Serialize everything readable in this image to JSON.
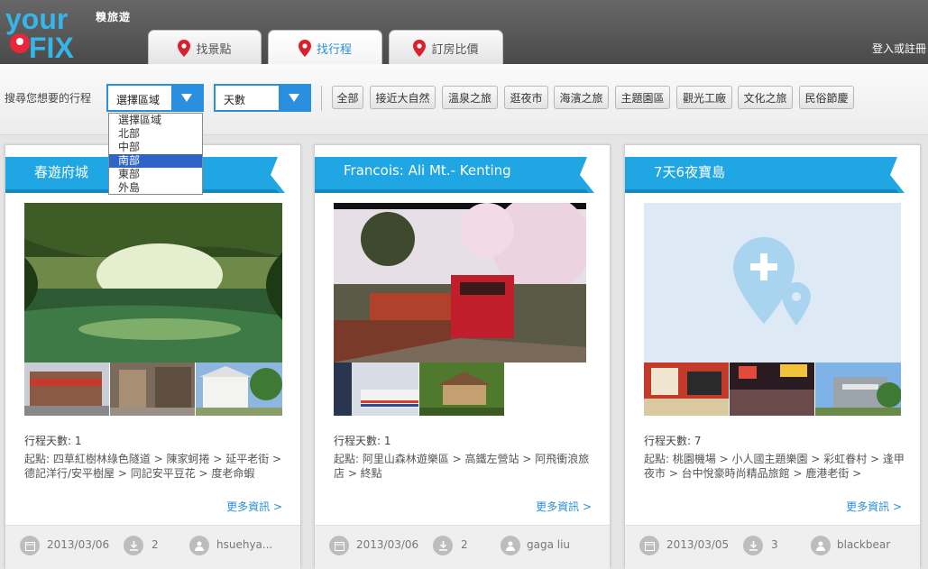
{
  "app": {
    "logo_text": "your FIX",
    "logo_sub": "糗旅遊",
    "login": "登入或註冊"
  },
  "tabs": [
    {
      "label": "找景點",
      "active": false
    },
    {
      "label": "找行程",
      "active": true
    },
    {
      "label": "訂房比價",
      "active": false
    }
  ],
  "search": {
    "label": "搜尋您想要的行程",
    "region_value": "選擇區域",
    "days_value": "天數",
    "region_options": [
      "選擇區域",
      "北部",
      "中部",
      "南部",
      "東部",
      "外島"
    ],
    "region_highlighted": "南部"
  },
  "filters": [
    "全部",
    "接近大自然",
    "溫泉之旅",
    "逛夜市",
    "海濱之旅",
    "主題園區",
    "觀光工廠",
    "文化之旅",
    "民俗節慶"
  ],
  "cards": [
    {
      "title": "春遊府城",
      "days": "行程天數: 1",
      "route": "起點: 四草紅樹林綠色隧道 > 陳家蚵捲 > 延平老街 > 德記洋行/安平樹屋 > 同記安平豆花 > 度老命蝦",
      "more": "更多資訊 >",
      "date": "2013/03/06",
      "downloads": "2",
      "user": "hsuehya..."
    },
    {
      "title": "Francois: Ali Mt.- Kenting",
      "days": "行程天數: 1",
      "route": "起點: 阿里山森林遊樂區 > 高鐵左營站 > 阿飛衝浪旅店 > 終點",
      "more": "更多資訊 >",
      "date": "2013/03/06",
      "downloads": "2",
      "user": "gaga liu"
    },
    {
      "title": "7天6夜寶島",
      "days": "行程天數: 7",
      "route": "起點: 桃園機場 > 小人國主題樂園 > 彩虹眷村 > 逢甲夜市 > 台中悅豪時尚精品旅館 > 鹿港老街 >",
      "more": "更多資訊 >",
      "date": "2013/03/05",
      "downloads": "3",
      "user": "blackbear"
    }
  ],
  "colors": {
    "accent": "#2b8fe0",
    "banner": "#1fa6e3",
    "header": "#555555"
  },
  "icons": {
    "tab": "map-pin-icon",
    "date": "calendar-icon",
    "download": "download-icon",
    "user": "user-icon",
    "placeholder": "add-location-icon"
  }
}
